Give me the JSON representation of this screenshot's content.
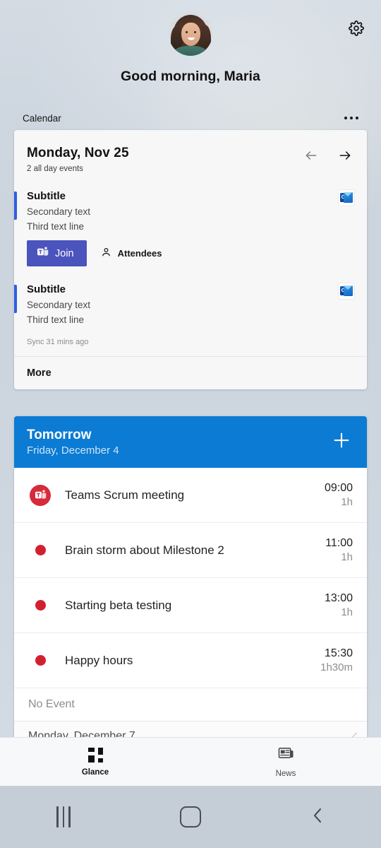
{
  "header": {
    "greeting": "Good morning, Maria",
    "avatar_name": "user-avatar-photo",
    "settings_icon": "gear-icon"
  },
  "section": {
    "title": "Calendar",
    "overflow_icon": "more-horizontal-icon"
  },
  "calendar_card": {
    "date": "Monday, Nov 25",
    "all_day_summary": "2 all day events",
    "prev_icon": "arrow-left-icon",
    "next_icon": "arrow-right-icon",
    "events": [
      {
        "title": "Subtitle",
        "secondary": "Secondary text",
        "third": "Third text line",
        "accent_color": "#2f5fe0",
        "app_icon": "outlook-icon",
        "join_label": "Join",
        "join_icon": "teams-icon",
        "attendees_label": "Attendees",
        "attendees_icon": "person-icon"
      },
      {
        "title": "Subtitle",
        "secondary": "Secondary text",
        "third": "Third text line",
        "accent_color": "#2f5fe0",
        "app_icon": "outlook-icon"
      }
    ],
    "sync_status": "Sync 31 mins ago",
    "more_label": "More"
  },
  "tomorrow_card": {
    "title": "Tomorrow",
    "subtitle": "Friday, December 4",
    "add_icon": "plus-icon",
    "header_color": "#0b7bd4",
    "events": [
      {
        "icon": "teams-icon",
        "name": "Teams Scrum meeting",
        "start": "09:00",
        "duration": "1h"
      },
      {
        "icon": "red-dot-icon",
        "name": "Brain storm about Milestone 2",
        "start": "11:00",
        "duration": "1h"
      },
      {
        "icon": "red-dot-icon",
        "name": "Starting beta testing",
        "start": "13:00",
        "duration": "1h"
      },
      {
        "icon": "red-dot-icon",
        "name": "Happy hours",
        "start": "15:30",
        "duration": "1h30m"
      }
    ],
    "no_event_label": "No Event",
    "next_day_label": "Monday, December 7",
    "lock_icon": "lock-badge-icon",
    "resize_icon": "resize-handle-icon"
  },
  "bottom_nav": {
    "items": [
      {
        "label": "Glance",
        "icon": "glance-grid-icon",
        "active": true
      },
      {
        "label": "News",
        "icon": "news-icon",
        "active": false
      }
    ]
  },
  "system_nav": {
    "recent_icon": "recent-apps-icon",
    "home_icon": "home-icon",
    "back_icon": "back-icon"
  },
  "colors": {
    "accent_blue": "#0b7bd4",
    "teams_purple": "#4b53bc",
    "event_red": "#d32030",
    "background": "#ccd4dd"
  }
}
